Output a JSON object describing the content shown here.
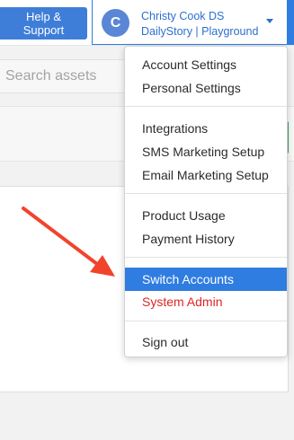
{
  "header": {
    "help_label": "Help & Support",
    "user": {
      "avatar_initial": "C",
      "name": "Christy Cook DS",
      "org": "DailyStory | Playground"
    }
  },
  "search": {
    "placeholder": "Search assets"
  },
  "menu": {
    "account_settings": "Account Settings",
    "personal_settings": "Personal Settings",
    "integrations": "Integrations",
    "sms_setup": "SMS Marketing Setup",
    "email_setup": "Email Marketing Setup",
    "product_usage": "Product Usage",
    "payment_history": "Payment History",
    "switch_accounts": "Switch Accounts",
    "system_admin": "System Admin",
    "sign_out": "Sign out"
  },
  "colors": {
    "accent": "#2f7de1",
    "help_button": "#3f7ed8",
    "danger": "#e02424",
    "annotation_arrow": "#f0442c",
    "success_tab": "#3aa757"
  },
  "annotation": {
    "arrow_icon": "red-arrow-pointing-to-switch-accounts"
  }
}
